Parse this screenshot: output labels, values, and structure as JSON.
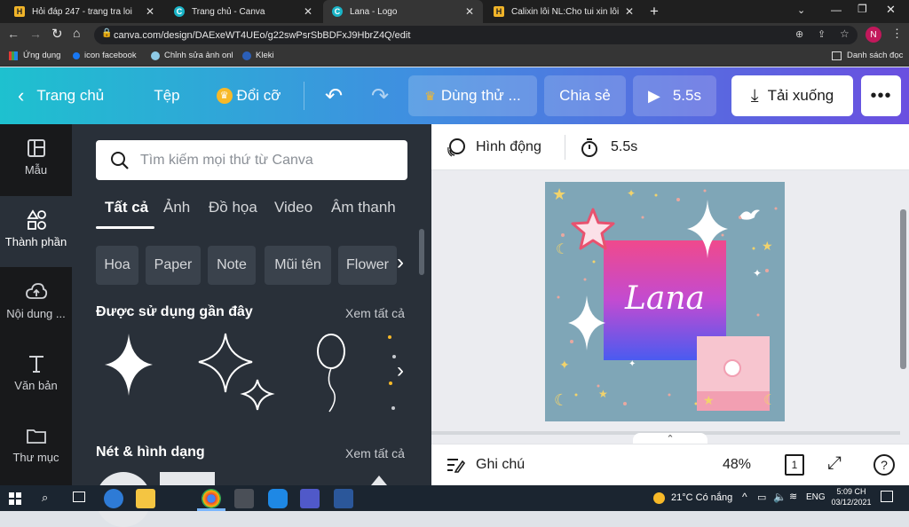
{
  "browser": {
    "tabs": [
      {
        "title": "Hỏi đáp 247 - trang tra loi",
        "favicon": "hoidap-icon"
      },
      {
        "title": "Trang chủ - Canva",
        "favicon": "canva-icon"
      },
      {
        "title": "Lana - Logo",
        "favicon": "canva-icon"
      },
      {
        "title": "Calixin lỗi NL:Cho tui xin lỗi mà ...",
        "favicon": "hoidap-icon"
      }
    ],
    "new_tab": "+",
    "url": "canva.com/design/DAExeWT4UEo/g22swPsrSbBDFxJ9HbrZ4Q/edit",
    "profile_initial": "N",
    "bookmarks": [
      "Ứng dụng",
      "icon facebook",
      "Chỉnh sửa ảnh onl",
      "Kleki"
    ],
    "reading_list": "Danh sách đọc"
  },
  "header": {
    "home": "Trang chủ",
    "file": "Tệp",
    "resize": "Đổi cỡ",
    "try": "Dùng thử ...",
    "share": "Chia sẻ",
    "duration": "5.5s",
    "download": "Tải xuống"
  },
  "rail": [
    {
      "label": "Mẫu",
      "icon": "template-icon"
    },
    {
      "label": "Thành phần",
      "icon": "elements-icon"
    },
    {
      "label": "Nội dung ...",
      "icon": "upload-cloud-icon"
    },
    {
      "label": "Văn bản",
      "icon": "text-icon"
    },
    {
      "label": "Thư mục",
      "icon": "folder-icon"
    }
  ],
  "panel": {
    "search_placeholder": "Tìm kiếm mọi thứ từ Canva",
    "categories": [
      "Tất cả",
      "Ảnh",
      "Đồ họa",
      "Video",
      "Âm thanh"
    ],
    "chips": [
      "Hoa",
      "Paper",
      "Note",
      "Mũi tên",
      "Flower"
    ],
    "recent_title": "Được sử dụng gần đây",
    "shapes_title": "Nét & hình dạng",
    "see_all": "Xem tất cả"
  },
  "editor": {
    "animate": "Hình động",
    "timer": "5.5s",
    "design_text": "Lana",
    "notes": "Ghi chú",
    "zoom": "48%",
    "page_count": "1",
    "help": "?"
  },
  "taskbar": {
    "weather": "21°C Có nắng",
    "lang": "ENG",
    "time": "5:09 CH",
    "date": "03/12/2021"
  },
  "colors": {
    "header_start": "#1ec1cf",
    "header_end": "#6a4fe0",
    "panel_bg": "#293039",
    "design_bg": "#7fa6b7"
  }
}
